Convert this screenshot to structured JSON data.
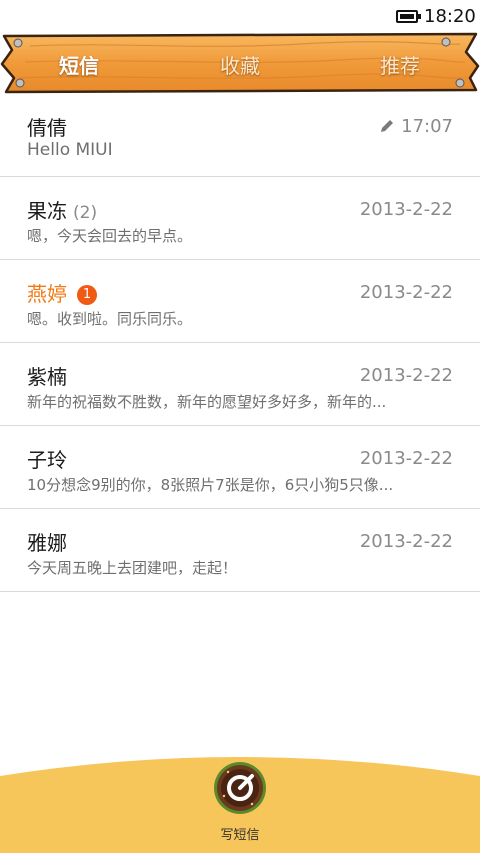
{
  "status_bar": {
    "time": "18:20",
    "battery_icon": "battery-full-icon"
  },
  "tabs": [
    {
      "label": "短信",
      "active": true
    },
    {
      "label": "收藏",
      "active": false
    },
    {
      "label": "推荐",
      "active": false
    }
  ],
  "messages": [
    {
      "name": "倩倩",
      "time": "17:07",
      "preview": "Hello MIUI",
      "draft": true
    },
    {
      "name": "果冻",
      "count": "(2)",
      "time": "2013-2-22",
      "preview": "嗯，今天会回去的早点。"
    },
    {
      "name": "燕婷",
      "badge": "1",
      "unread": true,
      "time": "2013-2-22",
      "preview": "嗯。收到啦。同乐同乐。"
    },
    {
      "name": "紫楠",
      "time": "2013-2-22",
      "preview": "新年的祝福数不胜数，新年的愿望好多好多，新年的..."
    },
    {
      "name": "子玲",
      "time": "2013-2-22",
      "preview": "10分想念9别的你，8张照片7张是你，6只小狗5只像..."
    },
    {
      "name": "雅娜",
      "time": "2013-2-22",
      "preview": "今天周五晚上去团建吧，走起！"
    }
  ],
  "compose": {
    "label": "写短信",
    "icon": "compose-burger-icon"
  },
  "colors": {
    "wood": "#f3a84c",
    "unread": "#f07b16",
    "badge": "#f05a14",
    "bottom": "#f7c65a"
  }
}
